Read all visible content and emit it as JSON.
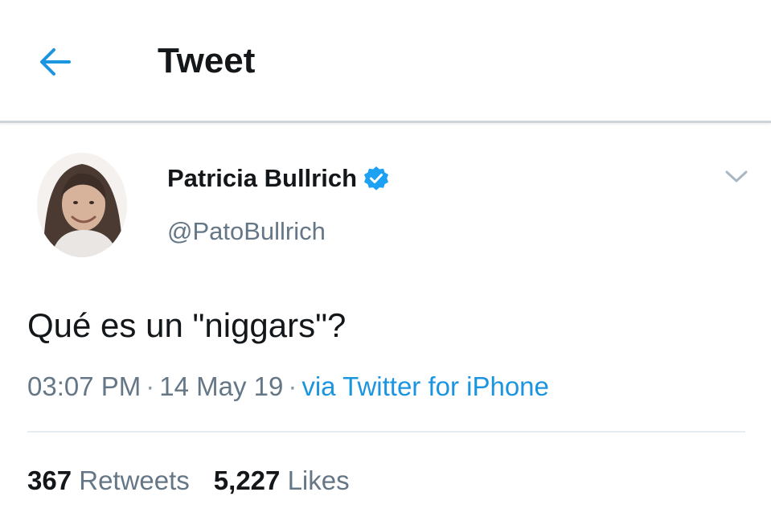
{
  "header": {
    "back_icon": "arrow-left-icon",
    "title": "Tweet"
  },
  "tweet": {
    "author": {
      "name": "Patricia Bullrich",
      "handle": "@PatoBullrich",
      "verified_icon": "verified-badge-icon",
      "avatar": "profile-photo"
    },
    "menu_icon": "chevron-down-icon",
    "text": "Qué es un \"niggars\"?",
    "time": "03:07 PM",
    "date": "14 May 19",
    "separator": "·",
    "source": "via Twitter for iPhone",
    "stats": {
      "retweets_count": "367",
      "retweets_label": "Retweets",
      "likes_count": "5,227",
      "likes_label": "Likes"
    }
  },
  "colors": {
    "accent": "#1b95e0",
    "text_primary": "#14171a",
    "text_secondary": "#657786",
    "divider": "#e6ecf0"
  }
}
